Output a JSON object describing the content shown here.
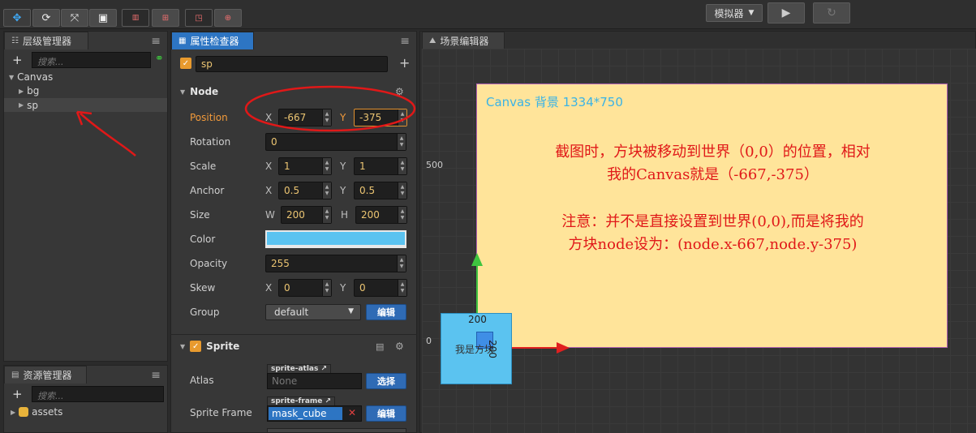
{
  "toolbar": {
    "simulator_label": "模拟器",
    "icons": [
      "move-tool",
      "rotate-tool",
      "scale-tool",
      "rect-tool",
      "anchor-toggle",
      "local-toggle",
      "snap-toggle",
      "world-toggle"
    ]
  },
  "hierarchy": {
    "tab_label": "层级管理器",
    "search_placeholder": "搜索...",
    "nodes": [
      {
        "label": "Canvas"
      },
      {
        "label": "bg"
      },
      {
        "label": "sp"
      }
    ]
  },
  "assets": {
    "tab_label": "资源管理器",
    "search_placeholder": "搜索...",
    "root": "assets"
  },
  "inspector": {
    "tab_label": "属性检查器",
    "node_name": "sp",
    "node_section": "Node",
    "position": {
      "label": "Position",
      "x_label": "X",
      "x": "-667",
      "y_label": "Y",
      "y": "-375"
    },
    "rotation": {
      "label": "Rotation",
      "value": "0"
    },
    "scale": {
      "label": "Scale",
      "x_label": "X",
      "x": "1",
      "y_label": "Y",
      "y": "1"
    },
    "anchor": {
      "label": "Anchor",
      "x_label": "X",
      "x": "0.5",
      "y_label": "Y",
      "y": "0.5"
    },
    "size": {
      "label": "Size",
      "w_label": "W",
      "w": "200",
      "h_label": "H",
      "h": "200"
    },
    "color": {
      "label": "Color",
      "value": "#5bc3f0"
    },
    "opacity": {
      "label": "Opacity",
      "value": "255"
    },
    "skew": {
      "label": "Skew",
      "x_label": "X",
      "x": "0",
      "y_label": "Y",
      "y": "0"
    },
    "group": {
      "label": "Group",
      "value": "default",
      "edit_label": "编辑"
    },
    "sprite_section": "Sprite",
    "atlas": {
      "label": "Atlas",
      "tag": "sprite-atlas",
      "value": "None",
      "select_label": "选择"
    },
    "sprite_frame": {
      "label": "Sprite Frame",
      "tag": "sprite-frame",
      "value": "mask_cube",
      "edit_label": "编辑"
    }
  },
  "scene": {
    "tab_label": "场景编辑器",
    "canvas_caption": "Canvas 背景 1334*750",
    "ruler_500": "500",
    "ruler_0": "0",
    "note_line1": "截图时，方块被移动到世界（0,0）的位置，相对",
    "note_line2": "我的Canvas就是（-667,-375）",
    "note_line3": "注意：并不是直接设置到世界(0,0),而是将我的",
    "note_line4": "方块node设为：(node.x-667,node.y-375)",
    "square_width_label": "200",
    "square_height_label": "200",
    "square_text": "我是方块"
  },
  "colors": {
    "accent_blue": "#2d75c3",
    "orange": "#f29a3a",
    "canvas_bg": "#ffe49a",
    "note_red": "#e01818",
    "square_blue": "#5bc3f0"
  }
}
